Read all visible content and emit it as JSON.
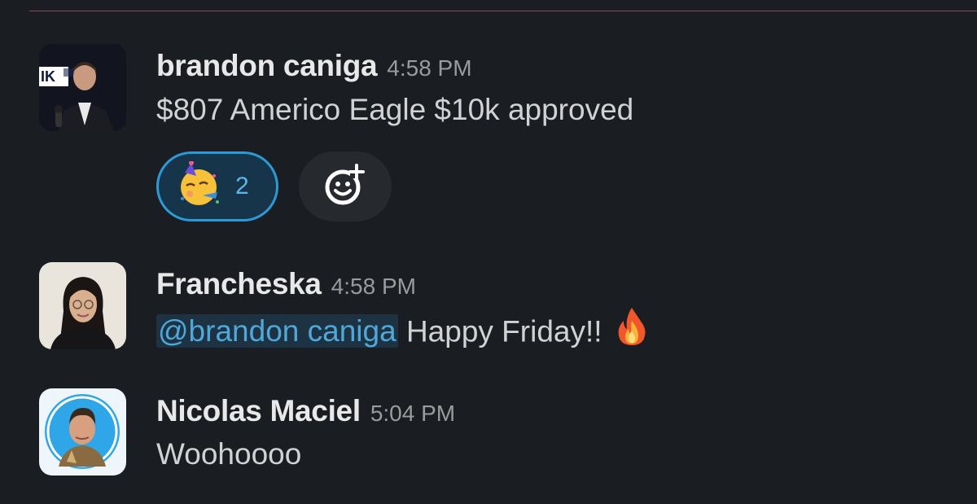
{
  "messages": [
    {
      "author": "brandon caniga",
      "time": "4:58 PM",
      "text": "$807 Americo Eagle $10k approved",
      "reactions": [
        {
          "emoji": "partying-face",
          "count": "2"
        }
      ]
    },
    {
      "author": "Francheska",
      "time": "4:58 PM",
      "mention": "@brandon caniga",
      "text": " Happy Friday!!",
      "emoji": "fire"
    },
    {
      "author": "Nicolas Maciel",
      "time": "5:04 PM",
      "text": "Woohoooo"
    }
  ],
  "colors": {
    "background": "#1a1d21",
    "mention_text": "#4fa8d8",
    "mention_bg": "#1d3343",
    "reaction_border": "#2d9ad8"
  },
  "icons": {
    "add_reaction": "add-reaction-icon",
    "reaction": "partying-face-icon",
    "inline": "fire-icon"
  }
}
